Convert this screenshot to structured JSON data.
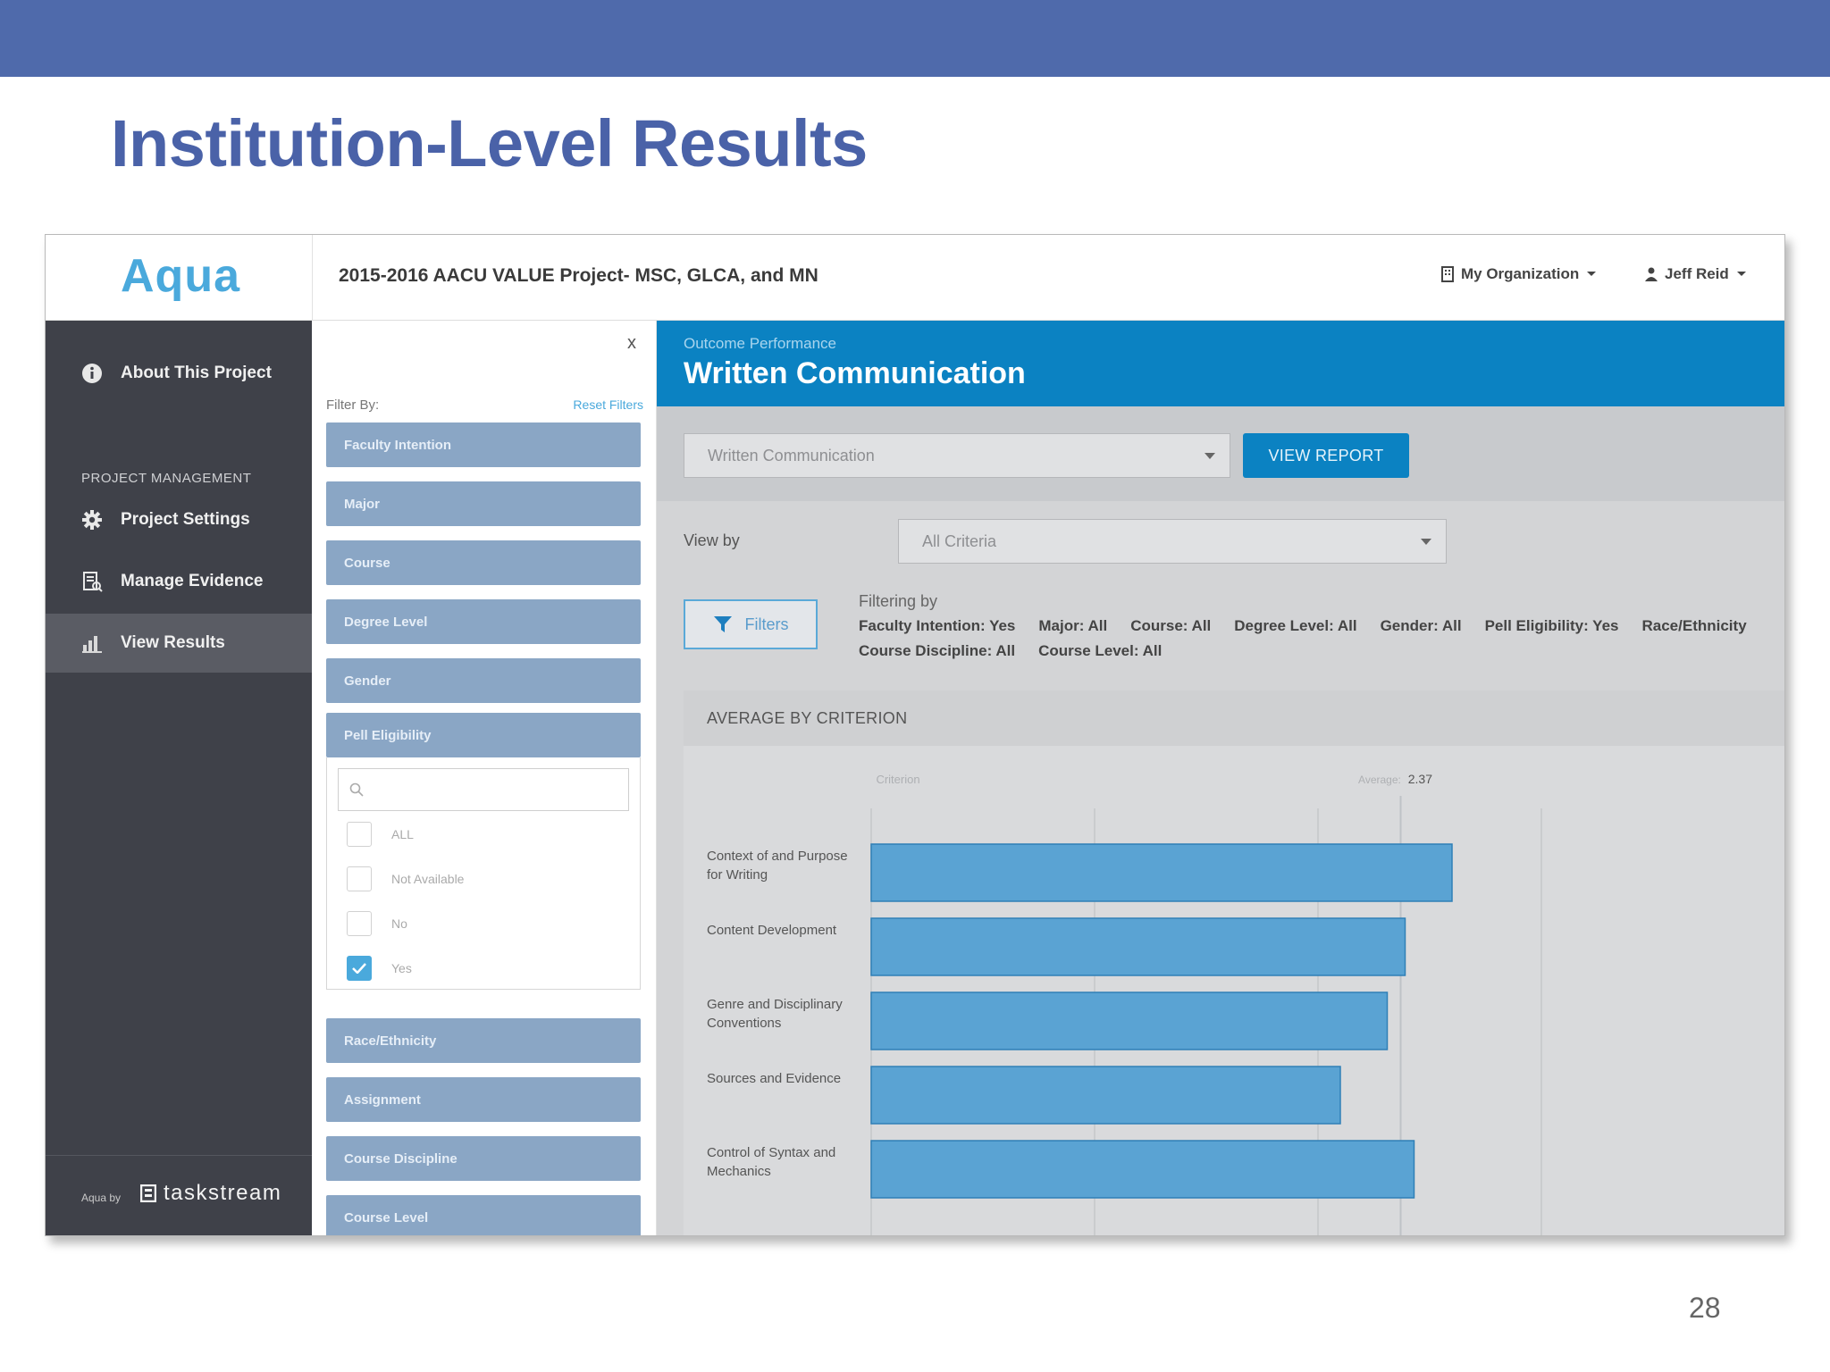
{
  "slide": {
    "title": "Institution-Level Results",
    "page_number": "28"
  },
  "colors": {
    "band": "#4f6aab",
    "accent": "#0b82c2",
    "bar": "#5aa3d3",
    "sidebar": "#3f4149"
  },
  "app": {
    "logo": "Aqua",
    "project_title": "2015-2016 AACU VALUE Project- MSC, GLCA, and MN",
    "org_menu": "My Organization",
    "user_menu": "Jeff Reid"
  },
  "sidebar": {
    "about": "About This Project",
    "section": "PROJECT MANAGEMENT",
    "items": [
      {
        "label": "Project Settings",
        "icon": "gear-icon"
      },
      {
        "label": "Manage Evidence",
        "icon": "evidence-icon"
      },
      {
        "label": "View Results",
        "icon": "chart-icon"
      }
    ],
    "footer_small": "Aqua by",
    "footer_brand": "taskstream"
  },
  "filter_panel": {
    "close": "x",
    "filter_by": "Filter By:",
    "reset": "Reset Filters",
    "filters": [
      "Faculty Intention",
      "Major",
      "Course",
      "Degree Level",
      "Gender",
      "Pell Eligibility",
      "Race/Ethnicity",
      "Assignment",
      "Course Discipline",
      "Course Level"
    ],
    "pell_options": [
      {
        "label": "ALL",
        "checked": false
      },
      {
        "label": "Not Available",
        "checked": false
      },
      {
        "label": "No",
        "checked": false
      },
      {
        "label": "Yes",
        "checked": true
      }
    ]
  },
  "main": {
    "banner_sub": "Outcome Performance",
    "banner_title": "Written Communication",
    "outcome_select": "Written Communication",
    "view_report": "VIEW REPORT",
    "view_by_label": "View by",
    "view_by_select": "All Criteria",
    "filters_button": "Filters",
    "filtering_title": "Filtering by",
    "filtering_line1": [
      "Faculty Intention: Yes",
      "Major: All",
      "Course: All",
      "Degree Level: All",
      "Gender: All",
      "Pell Eligibility: Yes",
      "Race/Ethnicity"
    ],
    "filtering_line2": [
      "Course Discipline: All",
      "Course Level: All"
    ],
    "chart_title": "AVERAGE BY CRITERION"
  },
  "chart_data": {
    "type": "bar",
    "orientation": "horizontal",
    "title": "AVERAGE BY CRITERION",
    "category_header": "Criterion",
    "average_label": "Average:",
    "average": 2.37,
    "xlim": [
      0,
      3
    ],
    "grid": true,
    "categories": [
      "Context of and Purpose for Writing",
      "Content Development",
      "Genre and Disciplinary Conventions",
      "Sources and Evidence",
      "Control of Syntax and Mechanics"
    ],
    "category_lines": [
      [
        "Context of and Purpose",
        "for Writing"
      ],
      [
        "Content Development"
      ],
      [
        "Genre and Disciplinary",
        "Conventions"
      ],
      [
        "Sources and Evidence"
      ],
      [
        "Control of Syntax and",
        "Mechanics"
      ]
    ],
    "values": [
      2.6,
      2.39,
      2.31,
      2.1,
      2.43
    ]
  }
}
